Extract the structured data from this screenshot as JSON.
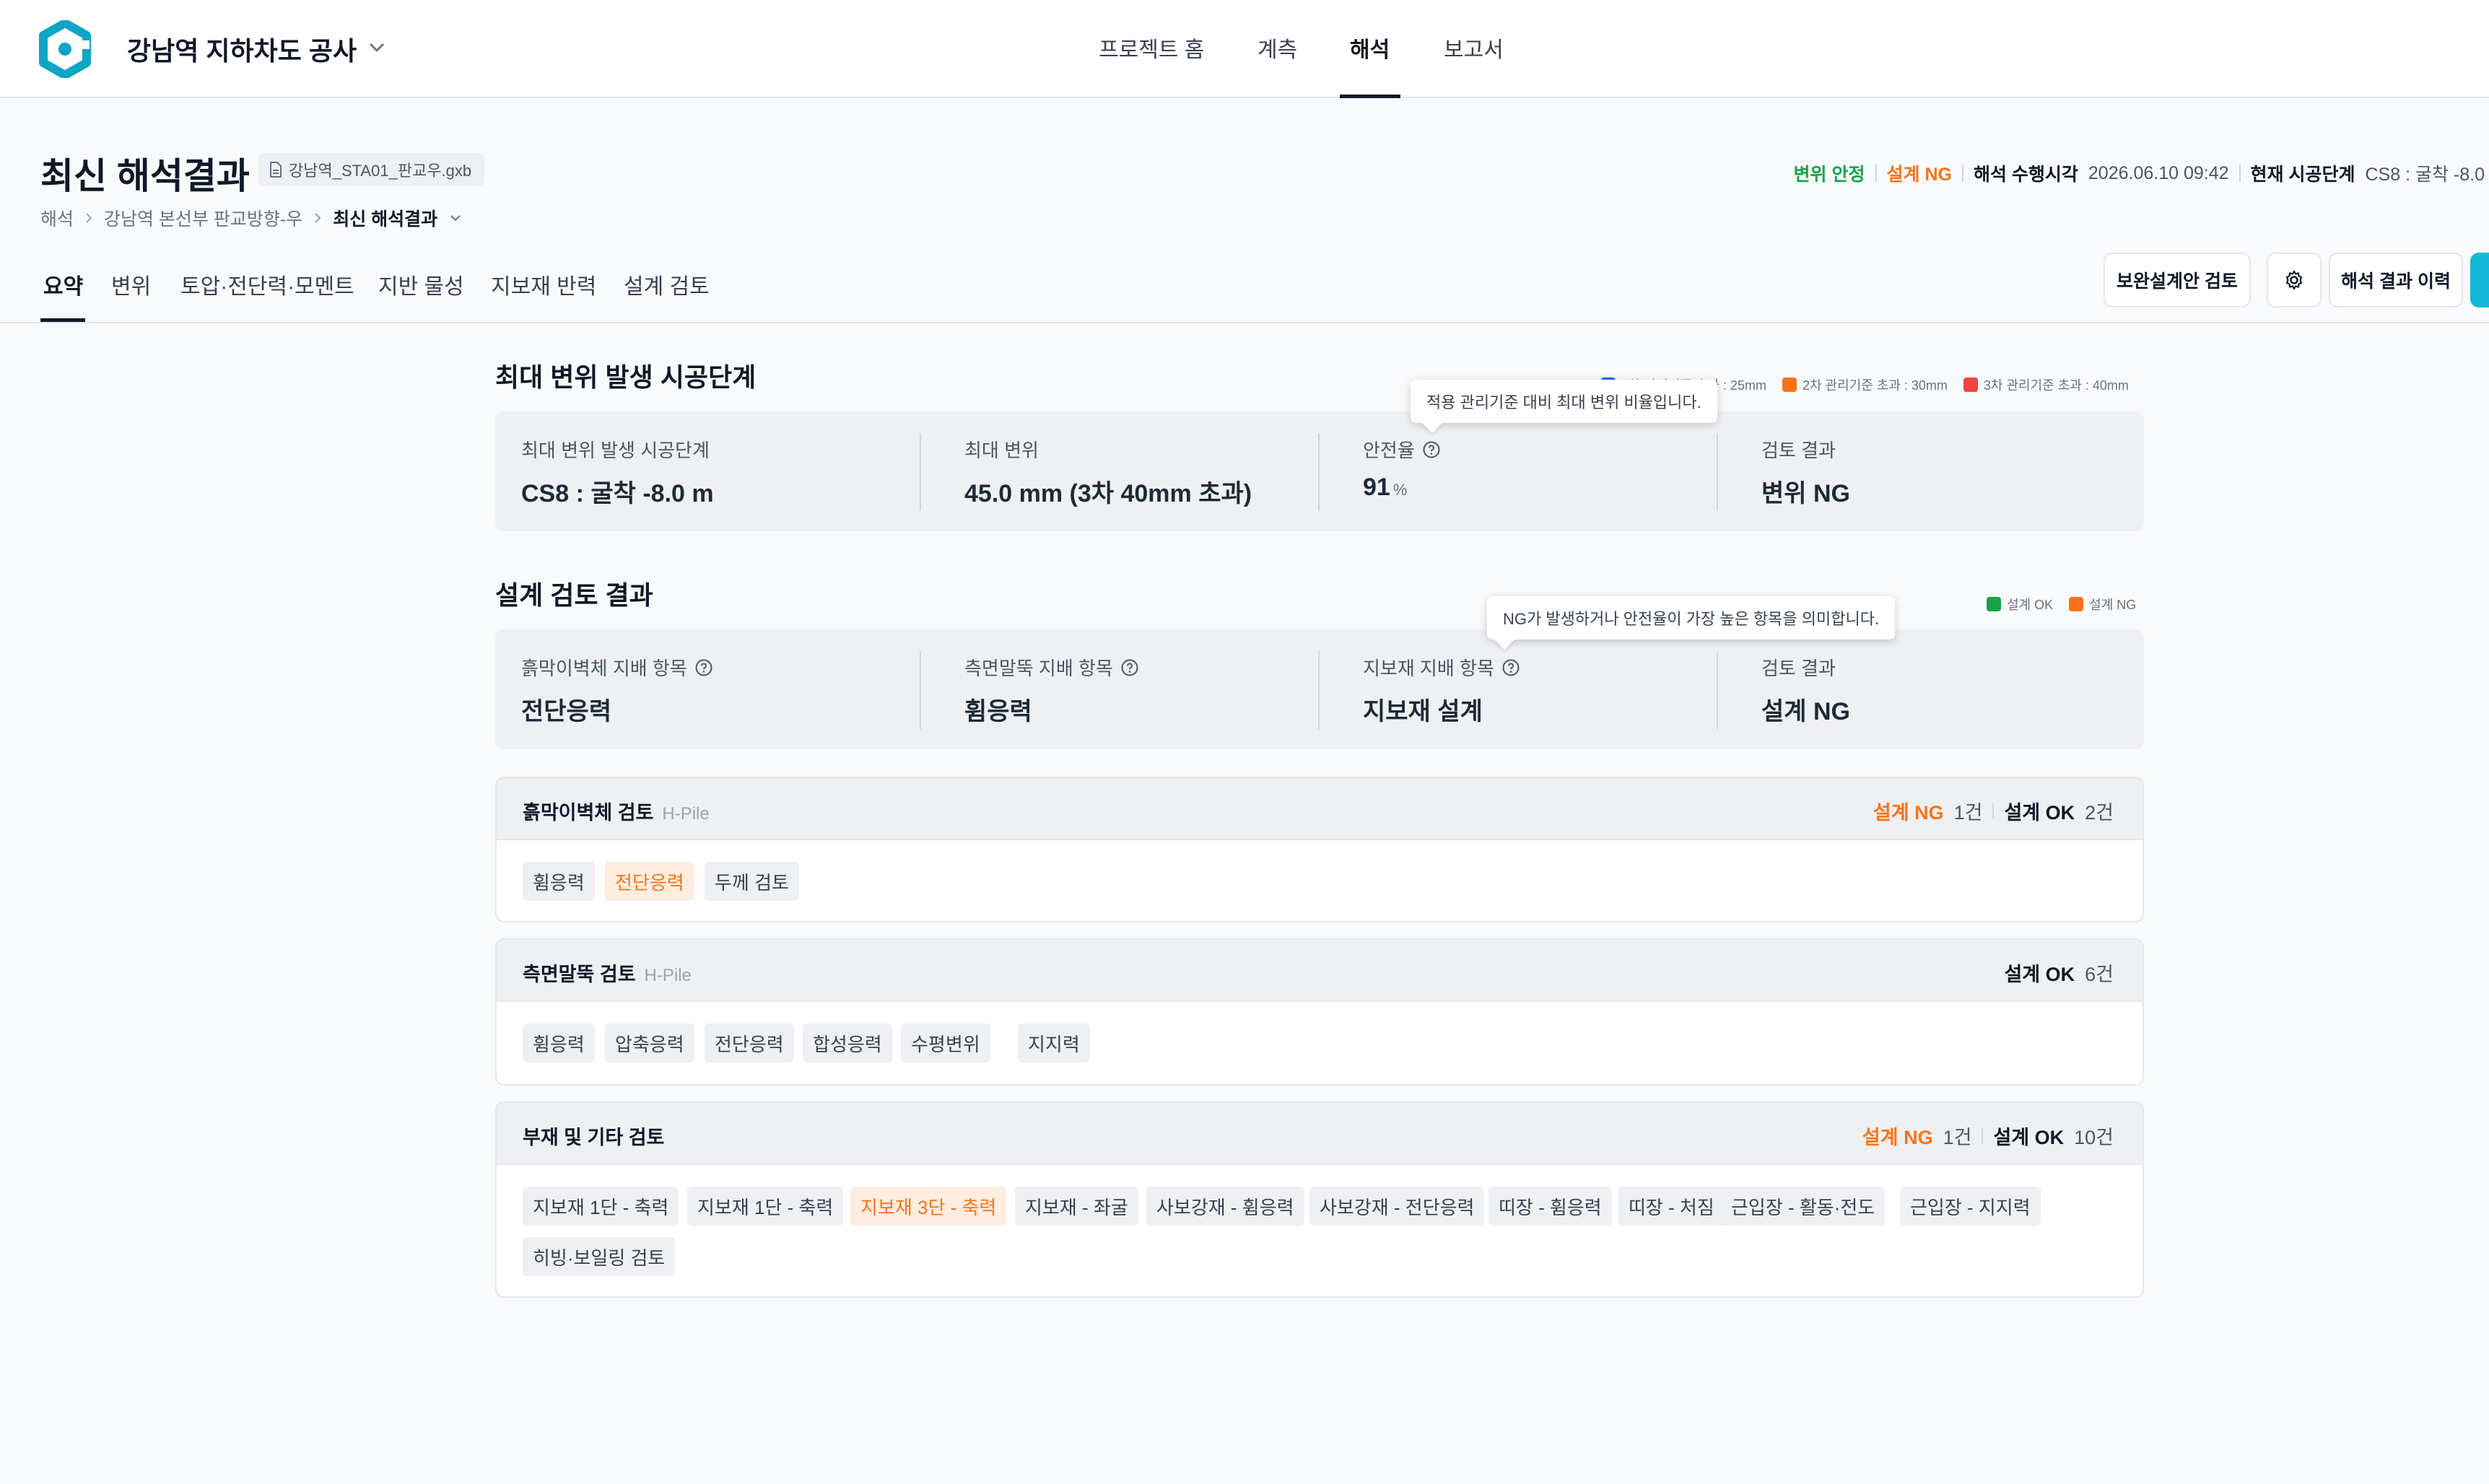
{
  "project": {
    "title": "강남역 지하차도 공사"
  },
  "nav": {
    "items": [
      "프로젝트 홈",
      "계측",
      "해석",
      "보고서"
    ],
    "active": "해석"
  },
  "header": {
    "title": "최신 해석결과",
    "file_chip": "강남역_STA01_판교우.gxb",
    "breadcrumb": [
      "해석",
      "강남역 본선부 판교방향-우",
      "최신 해석결과"
    ],
    "status": {
      "disp_stable": "변위 안정",
      "design_ng": "설계 NG",
      "run_time_label": "해석 수행시각",
      "run_time_value": "2026.06.10 09:42",
      "stage_label": "현재 시공단계",
      "stage_value": "CS8 : 굴착 -8.0"
    }
  },
  "tabs": [
    "요약",
    "변위",
    "토압·전단력·모멘트",
    "지반 물성",
    "지보재 반력",
    "설계 검토"
  ],
  "actions": {
    "alt_review": "보완설계안 검토",
    "history": "해석 결과 이력"
  },
  "max_disp": {
    "title": "최대 변위 발생 시공단계",
    "legend": [
      "1차 관리기준 초과 : 25mm",
      "2차 관리기준 초과 : 30mm",
      "3차 관리기준 초과 : 40mm"
    ],
    "legend_colors": [
      "#2563eb",
      "#f97316",
      "#ef4444"
    ],
    "tooltip": "적용 관리기준 대비 최대 변위 비율입니다.",
    "cols": [
      {
        "label": "최대 변위 발생 시공단계",
        "value": "CS8 : 굴착 -8.0 m"
      },
      {
        "label": "최대 변위",
        "value": "45.0 mm (3차 40mm 초과)"
      },
      {
        "label": "안전율",
        "value": "91",
        "unit": "%"
      },
      {
        "label": "검토 결과",
        "value": "변위 NG"
      }
    ]
  },
  "design_review": {
    "title": "설계 검토 결과",
    "legend": [
      "설계 OK",
      "설계 NG"
    ],
    "legend_colors": [
      "#16a34a",
      "#f97316"
    ],
    "tooltip": "NG가 발생하거나 안전율이 가장 높은 항목을 의미합니다.",
    "cols": [
      {
        "label": "흙막이벽체 지배 항목",
        "value": "전단응력"
      },
      {
        "label": "측면말뚝 지배 항목",
        "value": "휨응력"
      },
      {
        "label": "지보재 지배 항목",
        "value": "지보재 설계"
      },
      {
        "label": "검토 결과",
        "value": "설계 NG"
      }
    ]
  },
  "panels": [
    {
      "title": "흙막이벽체 검토",
      "sub": "H-Pile",
      "ng_label": "설계 NG",
      "ng_count": "1건",
      "ok_label": "설계 OK",
      "ok_count": "2건",
      "chips": [
        "휨응력",
        "전단응력",
        "두께 검토"
      ]
    },
    {
      "title": "측면말뚝 검토",
      "sub": "H-Pile",
      "ok_label": "설계 OK",
      "ok_count": "6건",
      "chips": [
        "휨응력",
        "압축응력",
        "전단응력",
        "합성응력",
        "수평변위",
        "지지력"
      ]
    },
    {
      "title": "부재 및 기타 검토",
      "ng_label": "설계 NG",
      "ng_count": "1건",
      "ok_label": "설계 OK",
      "ok_count": "10건",
      "chips": [
        "지보재 1단 - 축력",
        "지보재 1단 - 축력",
        "지보재 3단 - 축력",
        "지보재 - 좌굴",
        "사보강재 - 휨응력",
        "사보강재 - 전단응력",
        "띠장 - 휨응력",
        "띠장 - 처짐",
        "근입장 - 활동·전도",
        "근입장 - 지지력",
        "히빙·보일링 검토"
      ]
    }
  ]
}
